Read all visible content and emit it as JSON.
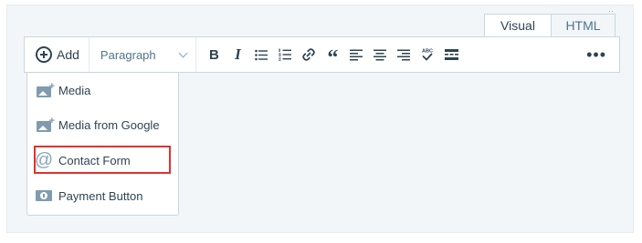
{
  "editor": {
    "tabs": [
      {
        "label": "Visual",
        "active": true
      },
      {
        "label": "HTML",
        "active": false
      }
    ],
    "resize_indicator": "··"
  },
  "toolbar": {
    "add_label": "Add",
    "format_select": {
      "selected": "Paragraph"
    },
    "tools": [
      {
        "name": "bold",
        "glyph": "B"
      },
      {
        "name": "italic",
        "glyph": "I"
      },
      {
        "name": "bulleted-list",
        "glyph": ""
      },
      {
        "name": "numbered-list",
        "glyph": ""
      },
      {
        "name": "link",
        "glyph": ""
      },
      {
        "name": "blockquote",
        "glyph": "“"
      },
      {
        "name": "align-left",
        "glyph": ""
      },
      {
        "name": "align-center",
        "glyph": ""
      },
      {
        "name": "align-right",
        "glyph": ""
      },
      {
        "name": "spellcheck",
        "glyph": "ABC"
      },
      {
        "name": "read-more",
        "glyph": ""
      }
    ],
    "more_glyph": "•••"
  },
  "add_menu": {
    "items": [
      {
        "label": "Media",
        "icon": "media-icon"
      },
      {
        "label": "Media from Google",
        "icon": "media-icon"
      },
      {
        "label": "Contact Form",
        "icon": "at-icon",
        "highlighted": true
      },
      {
        "label": "Payment Button",
        "icon": "payment-icon"
      }
    ],
    "at_glyph": "@",
    "plus_glyph": "+"
  },
  "colors": {
    "text": "#2e4453",
    "border": "#c8d7e1",
    "icon": "#7f9bb0",
    "frame_bg": "#f3f6f8",
    "highlight": "#e2312f"
  }
}
